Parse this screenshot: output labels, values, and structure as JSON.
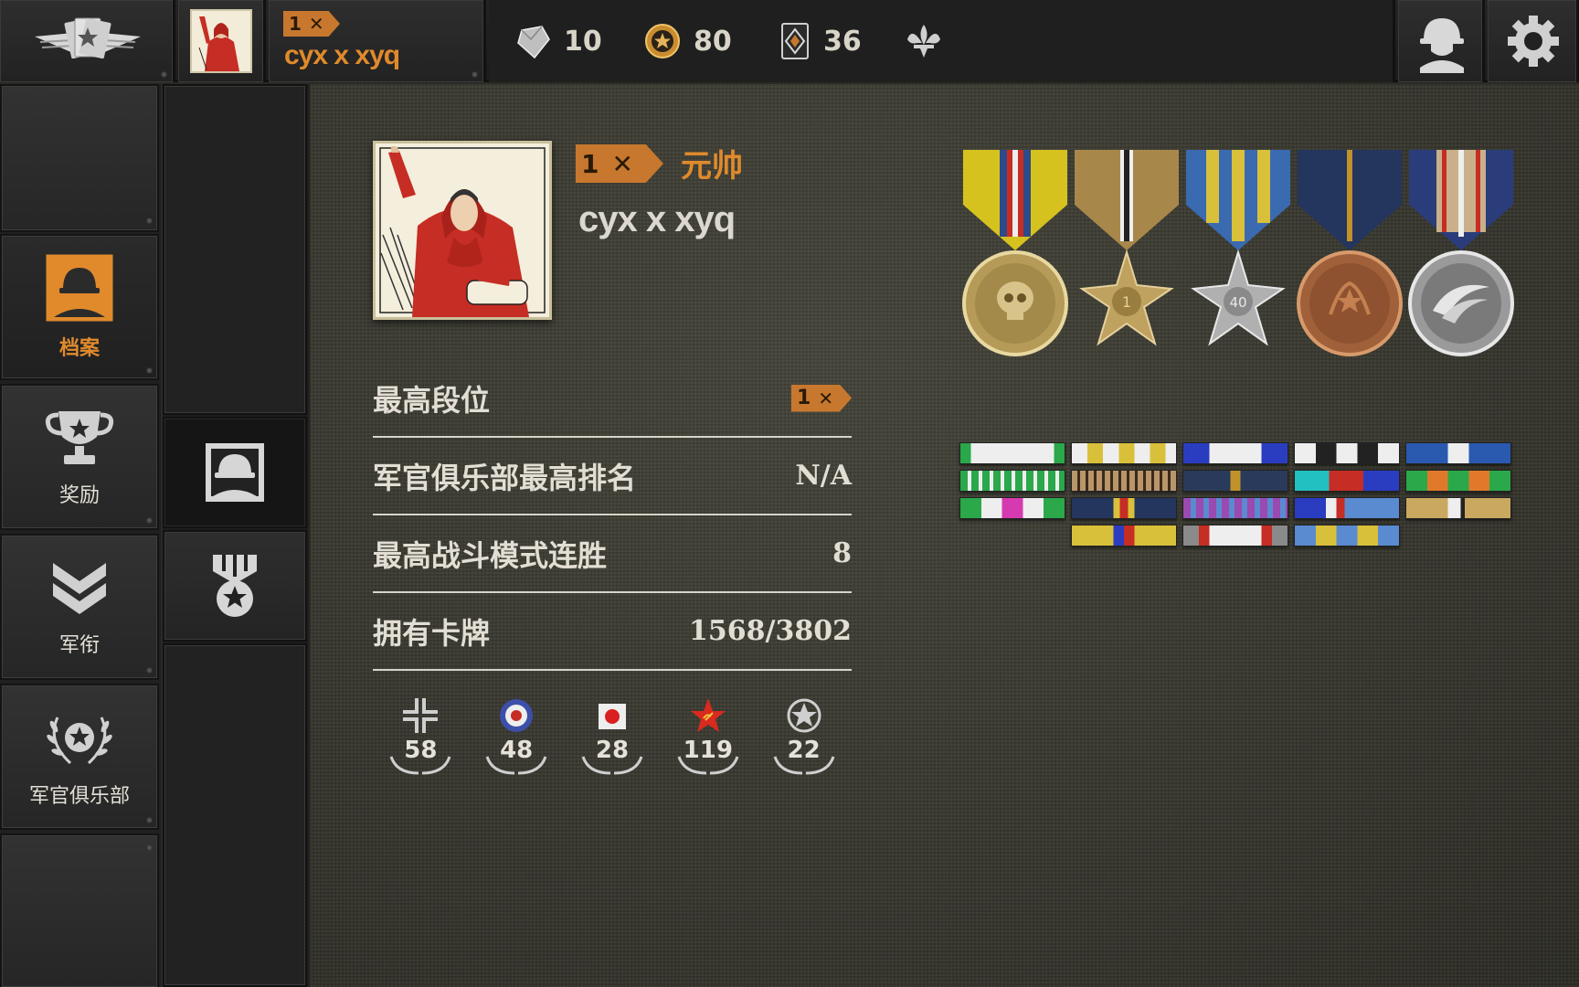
{
  "topbar": {
    "player_name": "cyx x xyq",
    "rank_chip": "1",
    "resources": [
      {
        "icon": "diamond-icon",
        "value": "10"
      },
      {
        "icon": "gold-coin-star-icon",
        "value": "80"
      },
      {
        "icon": "card-pack-icon",
        "value": "36"
      },
      {
        "icon": "fleur-de-lis-icon",
        "value": ""
      }
    ]
  },
  "leftnav": {
    "items": [
      {
        "label": "",
        "icon": ""
      },
      {
        "label": "档案",
        "icon": "helmet-portrait-icon",
        "active": true
      },
      {
        "label": "奖励",
        "icon": "trophy-icon"
      },
      {
        "label": "军衔",
        "icon": "chevron-rank-icon"
      },
      {
        "label": "军官俱乐部",
        "icon": "laurel-star-icon"
      }
    ]
  },
  "profile": {
    "rank_chip": "1",
    "rank_title": "元帅",
    "name": "cyx x xyq",
    "stats": [
      {
        "label": "最高段位",
        "value": ""
      },
      {
        "label": "军官俱乐部最高排名",
        "value": "N/A"
      },
      {
        "label": "最高战斗模式连胜",
        "value": "8"
      },
      {
        "label": "拥有卡牌",
        "value": "1568/3802"
      }
    ],
    "stat0_chip": "1",
    "factions": [
      {
        "icon": "iron-cross-icon",
        "value": "58"
      },
      {
        "icon": "raf-roundel-icon",
        "value": "48"
      },
      {
        "icon": "rising-sun-flag-icon",
        "value": "28"
      },
      {
        "icon": "soviet-star-icon",
        "value": "119"
      },
      {
        "icon": "us-star-icon",
        "value": "22"
      }
    ]
  },
  "colors": {
    "accent": "#e08a2c",
    "chip": "#c7782e",
    "text": "#e2ded4"
  }
}
